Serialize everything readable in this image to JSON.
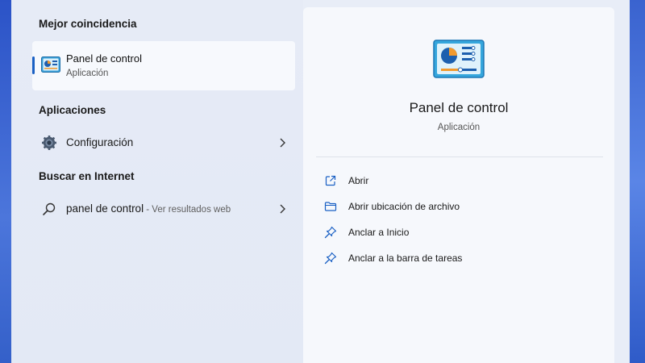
{
  "best_match": {
    "heading": "Mejor coincidencia",
    "title": "Panel de control",
    "subtitle": "Aplicación",
    "icon": "control-panel-icon"
  },
  "apps": {
    "heading": "Aplicaciones",
    "items": [
      {
        "label": "Configuración",
        "icon": "gear-icon"
      }
    ]
  },
  "web": {
    "heading": "Buscar en Internet",
    "query": "panel de control",
    "suffix": " - Ver resultados web",
    "icon": "search-icon"
  },
  "details": {
    "title": "Panel de control",
    "subtitle": "Aplicación",
    "actions": [
      {
        "label": "Abrir",
        "icon": "open-external-icon"
      },
      {
        "label": "Abrir ubicación de archivo",
        "icon": "folder-icon"
      },
      {
        "label": "Anclar a Inicio",
        "icon": "pin-icon"
      },
      {
        "label": "Anclar a la barra de tareas",
        "icon": "pin-icon"
      }
    ]
  },
  "colors": {
    "accent": "#1a60c4",
    "panel_bg": "#e8edf7",
    "detail_bg": "#f6f8fc"
  }
}
